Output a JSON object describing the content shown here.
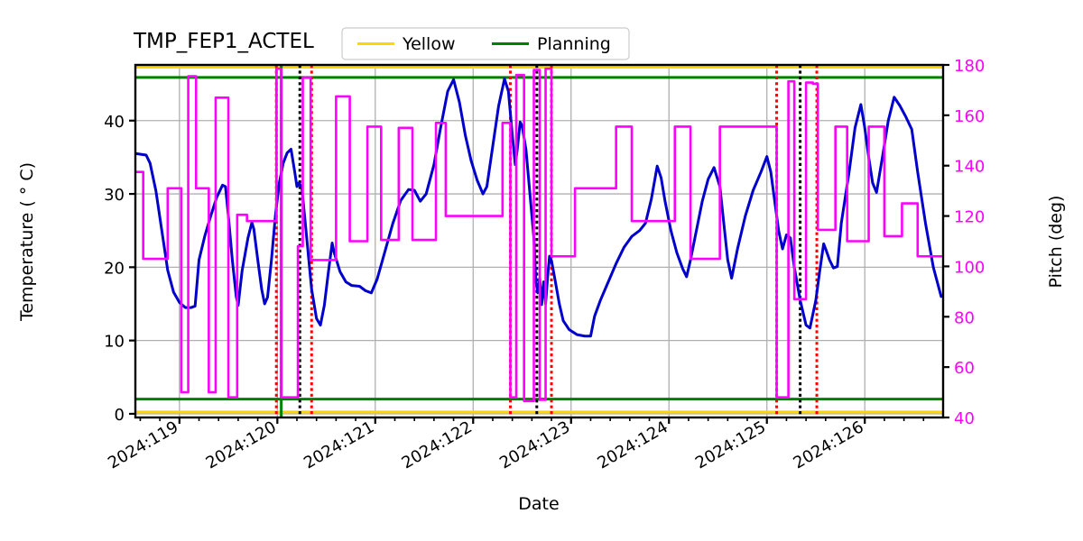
{
  "chart_data": {
    "type": "line",
    "title": "TMP_FEP1_ACTEL",
    "xlabel": "Date",
    "ylabel": "Temperature ( ° C)",
    "y2label": "Pitch (deg)",
    "xlim": [
      118.55,
      126.8
    ],
    "ylim": [
      -0.5,
      47.6
    ],
    "y2lim": [
      40,
      180
    ],
    "grid": true,
    "legend_position": "upper center",
    "legend": [
      {
        "label": "Yellow",
        "color": "#FFD700"
      },
      {
        "label": "Planning",
        "color": "#008000"
      }
    ],
    "x_ticks": [
      119,
      120,
      121,
      122,
      123,
      124,
      125,
      126
    ],
    "x_tick_labels": [
      "2024:119",
      "2024:120",
      "2024:121",
      "2024:122",
      "2024:123",
      "2024:124",
      "2024:125",
      "2024:126"
    ],
    "y_ticks": [
      0,
      10,
      20,
      30,
      40
    ],
    "y_tick_labels": [
      "0",
      "10",
      "20",
      "30",
      "40"
    ],
    "y2_ticks": [
      40,
      60,
      80,
      100,
      120,
      140,
      160,
      180
    ],
    "y2_tick_labels": [
      "40",
      "60",
      "80",
      "100",
      "120",
      "140",
      "160",
      "180"
    ],
    "limit_lines": [
      {
        "name": "yellow-upper",
        "axis": "left",
        "value": 47.3,
        "color": "#FFD700",
        "style": "solid"
      },
      {
        "name": "planning-upper",
        "axis": "left",
        "value": 45.9,
        "color": "#008000",
        "style": "solid"
      },
      {
        "name": "planning-lower",
        "axis": "left",
        "value": 2.0,
        "color": "#008000",
        "style": "solid"
      },
      {
        "name": "yellow-lower",
        "axis": "left",
        "value": 0.25,
        "color": "#FFD700",
        "style": "solid"
      }
    ],
    "vertical_lines": [
      {
        "x": 119.99,
        "color": "#FF0000",
        "style": "dotted"
      },
      {
        "x": 120.04,
        "color": "#008000",
        "style": "solid"
      },
      {
        "x": 120.23,
        "color": "#000000",
        "style": "dotted"
      },
      {
        "x": 120.35,
        "color": "#FF0000",
        "style": "dotted"
      },
      {
        "x": 122.38,
        "color": "#FF0000",
        "style": "dotted"
      },
      {
        "x": 122.65,
        "color": "#000000",
        "style": "dotted"
      },
      {
        "x": 122.8,
        "color": "#FF0000",
        "style": "dotted"
      },
      {
        "x": 125.1,
        "color": "#FF0000",
        "style": "dotted"
      },
      {
        "x": 125.34,
        "color": "#000000",
        "style": "dotted"
      },
      {
        "x": 125.51,
        "color": "#FF0000",
        "style": "dotted"
      }
    ],
    "series": [
      {
        "name": "Temperature",
        "color": "#0000CC",
        "axis": "left",
        "style": "line",
        "points": [
          [
            118.56,
            35.5
          ],
          [
            118.66,
            35.3
          ],
          [
            118.7,
            34.2
          ],
          [
            118.76,
            30.4
          ],
          [
            118.82,
            25.0
          ],
          [
            118.88,
            19.6
          ],
          [
            118.94,
            16.6
          ],
          [
            119.0,
            15.2
          ],
          [
            119.06,
            14.5
          ],
          [
            119.12,
            14.5
          ],
          [
            119.16,
            14.7
          ],
          [
            119.2,
            21.0
          ],
          [
            119.26,
            24.3
          ],
          [
            119.32,
            27.0
          ],
          [
            119.38,
            29.5
          ],
          [
            119.44,
            31.2
          ],
          [
            119.47,
            31.0
          ],
          [
            119.5,
            27.0
          ],
          [
            119.54,
            21.0
          ],
          [
            119.58,
            16.0
          ],
          [
            119.6,
            14.8
          ],
          [
            119.64,
            19.5
          ],
          [
            119.7,
            24.0
          ],
          [
            119.74,
            26.1
          ],
          [
            119.76,
            25.2
          ],
          [
            119.8,
            21.0
          ],
          [
            119.84,
            17.0
          ],
          [
            119.87,
            15.0
          ],
          [
            119.9,
            15.9
          ],
          [
            119.94,
            21.0
          ],
          [
            119.98,
            27.0
          ],
          [
            120.02,
            31.5
          ],
          [
            120.06,
            34.2
          ],
          [
            120.1,
            35.6
          ],
          [
            120.14,
            36.1
          ],
          [
            120.18,
            32.8
          ],
          [
            120.2,
            31.0
          ],
          [
            120.22,
            31.5
          ],
          [
            120.25,
            30.9
          ],
          [
            120.3,
            24.0
          ],
          [
            120.35,
            17.0
          ],
          [
            120.4,
            13.0
          ],
          [
            120.44,
            12.1
          ],
          [
            120.48,
            14.8
          ],
          [
            120.52,
            19.2
          ],
          [
            120.56,
            23.3
          ],
          [
            120.58,
            22.0
          ],
          [
            120.64,
            19.4
          ],
          [
            120.7,
            18.0
          ],
          [
            120.76,
            17.5
          ],
          [
            120.84,
            17.4
          ],
          [
            120.9,
            16.8
          ],
          [
            120.96,
            16.5
          ],
          [
            121.02,
            18.4
          ],
          [
            121.1,
            22.2
          ],
          [
            121.18,
            26.0
          ],
          [
            121.26,
            29.1
          ],
          [
            121.34,
            30.6
          ],
          [
            121.4,
            30.5
          ],
          [
            121.46,
            29.0
          ],
          [
            121.52,
            30.0
          ],
          [
            121.6,
            34.0
          ],
          [
            121.66,
            38.5
          ],
          [
            121.74,
            44.0
          ],
          [
            121.8,
            45.6
          ],
          [
            121.86,
            42.5
          ],
          [
            121.92,
            38.0
          ],
          [
            121.98,
            34.5
          ],
          [
            122.04,
            31.9
          ],
          [
            122.1,
            30.0
          ],
          [
            122.14,
            31.0
          ],
          [
            122.2,
            36.5
          ],
          [
            122.26,
            42.0
          ],
          [
            122.32,
            45.7
          ],
          [
            122.36,
            44.0
          ],
          [
            122.4,
            38.0
          ],
          [
            122.43,
            34.0
          ],
          [
            122.45,
            36.0
          ],
          [
            122.48,
            39.8
          ],
          [
            122.5,
            39.3
          ],
          [
            122.54,
            36.0
          ],
          [
            122.58,
            30.0
          ],
          [
            122.62,
            24.0
          ],
          [
            122.64,
            18.2
          ],
          [
            122.66,
            16.5
          ],
          [
            122.68,
            18.5
          ],
          [
            122.7,
            14.9
          ],
          [
            122.72,
            18.0
          ],
          [
            122.74,
            15.0
          ],
          [
            122.76,
            18.6
          ],
          [
            122.78,
            21.5
          ],
          [
            122.8,
            20.9
          ],
          [
            122.84,
            18.0
          ],
          [
            122.88,
            15.0
          ],
          [
            122.92,
            12.7
          ],
          [
            122.98,
            11.5
          ],
          [
            123.06,
            10.8
          ],
          [
            123.14,
            10.6
          ],
          [
            123.2,
            10.6
          ],
          [
            123.24,
            13.3
          ],
          [
            123.3,
            15.5
          ],
          [
            123.38,
            18.0
          ],
          [
            123.46,
            20.5
          ],
          [
            123.54,
            22.7
          ],
          [
            123.62,
            24.2
          ],
          [
            123.7,
            25.0
          ],
          [
            123.76,
            26.0
          ],
          [
            123.82,
            29.3
          ],
          [
            123.88,
            33.8
          ],
          [
            123.92,
            32.2
          ],
          [
            123.96,
            29.0
          ],
          [
            124.02,
            25.0
          ],
          [
            124.08,
            22.0
          ],
          [
            124.14,
            19.8
          ],
          [
            124.18,
            18.7
          ],
          [
            124.22,
            21.0
          ],
          [
            124.28,
            25.0
          ],
          [
            124.34,
            29.0
          ],
          [
            124.4,
            32.0
          ],
          [
            124.46,
            33.6
          ],
          [
            124.52,
            31.0
          ],
          [
            124.56,
            26.0
          ],
          [
            124.6,
            21.0
          ],
          [
            124.64,
            18.5
          ],
          [
            124.7,
            22.5
          ],
          [
            124.78,
            27.0
          ],
          [
            124.86,
            30.5
          ],
          [
            124.94,
            33.0
          ],
          [
            125.0,
            35.1
          ],
          [
            125.04,
            33.0
          ],
          [
            125.08,
            29.0
          ],
          [
            125.12,
            25.0
          ],
          [
            125.16,
            22.5
          ],
          [
            125.2,
            24.4
          ],
          [
            125.24,
            24.0
          ],
          [
            125.28,
            20.0
          ],
          [
            125.34,
            15.5
          ],
          [
            125.4,
            12.1
          ],
          [
            125.44,
            11.7
          ],
          [
            125.5,
            15.5
          ],
          [
            125.54,
            19.5
          ],
          [
            125.58,
            23.2
          ],
          [
            125.6,
            22.5
          ],
          [
            125.64,
            21.0
          ],
          [
            125.68,
            19.9
          ],
          [
            125.72,
            20.1
          ],
          [
            125.76,
            26.0
          ],
          [
            125.84,
            33.0
          ],
          [
            125.9,
            39.0
          ],
          [
            125.96,
            42.2
          ],
          [
            126.0,
            39.0
          ],
          [
            126.04,
            35.0
          ],
          [
            126.08,
            31.5
          ],
          [
            126.12,
            30.2
          ],
          [
            126.18,
            35.0
          ],
          [
            126.24,
            40.0
          ],
          [
            126.3,
            43.2
          ],
          [
            126.36,
            42.0
          ],
          [
            126.42,
            40.5
          ],
          [
            126.48,
            38.8
          ],
          [
            126.54,
            33.0
          ],
          [
            126.62,
            26.0
          ],
          [
            126.7,
            20.0
          ],
          [
            126.78,
            16.0
          ]
        ]
      },
      {
        "name": "Pitch",
        "color": "#FF00FF",
        "axis": "right",
        "style": "step",
        "points": [
          [
            118.56,
            137.5
          ],
          [
            118.63,
            137.5
          ],
          [
            118.63,
            103.0
          ],
          [
            118.88,
            103.0
          ],
          [
            118.88,
            131.0
          ],
          [
            119.02,
            131.0
          ],
          [
            119.02,
            50.0
          ],
          [
            119.09,
            50.0
          ],
          [
            119.09,
            175.5
          ],
          [
            119.17,
            175.5
          ],
          [
            119.17,
            131.0
          ],
          [
            119.3,
            131.0
          ],
          [
            119.3,
            50.0
          ],
          [
            119.37,
            50.0
          ],
          [
            119.37,
            167.0
          ],
          [
            119.5,
            167.0
          ],
          [
            119.5,
            48.0
          ],
          [
            119.59,
            48.0
          ],
          [
            119.59,
            120.5
          ],
          [
            119.69,
            120.5
          ],
          [
            119.69,
            118.0
          ],
          [
            119.99,
            118.0
          ],
          [
            119.99,
            178.5
          ],
          [
            120.04,
            178.5
          ],
          [
            120.04,
            48.0
          ],
          [
            120.21,
            48.0
          ],
          [
            120.21,
            108.0
          ],
          [
            120.26,
            108.0
          ],
          [
            120.26,
            175.0
          ],
          [
            120.34,
            175.0
          ],
          [
            120.34,
            102.5
          ],
          [
            120.6,
            102.5
          ],
          [
            120.6,
            167.5
          ],
          [
            120.74,
            167.5
          ],
          [
            120.74,
            110.0
          ],
          [
            120.92,
            110.0
          ],
          [
            120.92,
            155.5
          ],
          [
            121.06,
            155.5
          ],
          [
            121.06,
            110.5
          ],
          [
            121.24,
            110.5
          ],
          [
            121.24,
            155.0
          ],
          [
            121.38,
            155.0
          ],
          [
            121.38,
            110.5
          ],
          [
            121.62,
            110.5
          ],
          [
            121.62,
            157.0
          ],
          [
            121.72,
            157.0
          ],
          [
            121.72,
            120.0
          ],
          [
            122.3,
            120.0
          ],
          [
            122.3,
            157.0
          ],
          [
            122.38,
            157.0
          ],
          [
            122.38,
            48.0
          ],
          [
            122.44,
            48.0
          ],
          [
            122.44,
            176.0
          ],
          [
            122.52,
            176.0
          ],
          [
            122.52,
            46.5
          ],
          [
            122.62,
            46.5
          ],
          [
            122.62,
            178.0
          ],
          [
            122.68,
            178.0
          ],
          [
            122.68,
            47.0
          ],
          [
            122.74,
            47.0
          ],
          [
            122.74,
            178.5
          ],
          [
            122.8,
            178.5
          ],
          [
            122.8,
            104.0
          ],
          [
            123.04,
            104.0
          ],
          [
            123.04,
            131.0
          ],
          [
            123.46,
            131.0
          ],
          [
            123.46,
            155.5
          ],
          [
            123.62,
            155.5
          ],
          [
            123.62,
            118.0
          ],
          [
            124.06,
            118.0
          ],
          [
            124.06,
            155.5
          ],
          [
            124.22,
            155.5
          ],
          [
            124.22,
            103.0
          ],
          [
            124.52,
            103.0
          ],
          [
            124.52,
            155.5
          ],
          [
            124.76,
            155.5
          ],
          [
            124.76,
            155.5
          ],
          [
            125.1,
            155.5
          ],
          [
            125.1,
            48.0
          ],
          [
            125.22,
            48.0
          ],
          [
            125.22,
            173.5
          ],
          [
            125.28,
            173.5
          ],
          [
            125.28,
            87.0
          ],
          [
            125.4,
            87.0
          ],
          [
            125.4,
            173.0
          ],
          [
            125.47,
            173.0
          ],
          [
            125.47,
            172.5
          ],
          [
            125.52,
            172.5
          ],
          [
            125.52,
            114.5
          ],
          [
            125.7,
            114.5
          ],
          [
            125.7,
            155.5
          ],
          [
            125.82,
            155.5
          ],
          [
            125.82,
            110.0
          ],
          [
            126.04,
            110.0
          ],
          [
            126.04,
            155.5
          ],
          [
            126.2,
            155.5
          ],
          [
            126.2,
            112.0
          ],
          [
            126.38,
            112.0
          ],
          [
            126.38,
            125.0
          ],
          [
            126.54,
            125.0
          ],
          [
            126.54,
            104.0
          ],
          [
            126.78,
            104.0
          ]
        ]
      }
    ]
  }
}
